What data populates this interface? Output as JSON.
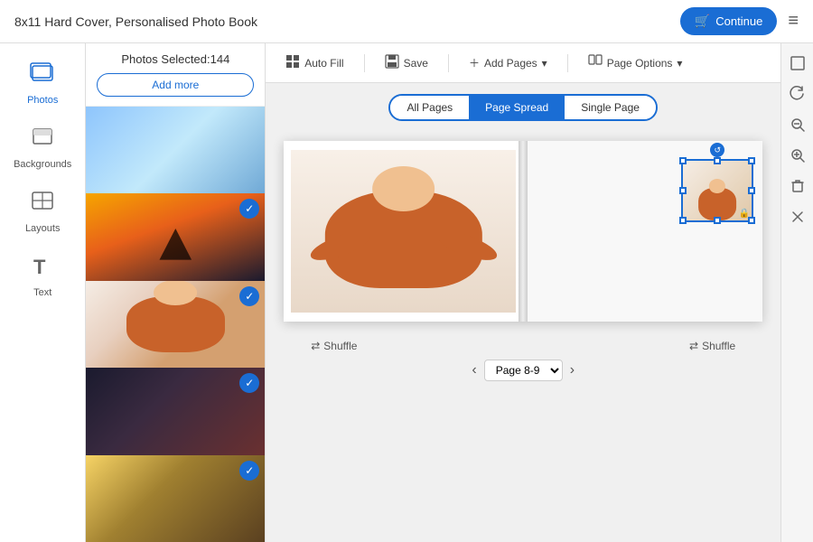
{
  "header": {
    "title": "8x11 Hard Cover, Personalised Photo Book",
    "continue_label": "Continue"
  },
  "toolbar": {
    "autofill_label": "Auto Fill",
    "save_label": "Save",
    "add_pages_label": "Add Pages",
    "page_options_label": "Page Options"
  },
  "view_tabs": {
    "all_pages_label": "All Pages",
    "page_spread_label": "Page Spread",
    "single_page_label": "Single Page",
    "active": "page_spread"
  },
  "sidebar": {
    "items": [
      {
        "id": "photos",
        "label": "Photos",
        "icon": "🖼"
      },
      {
        "id": "backgrounds",
        "label": "Backgrounds",
        "icon": "🗂"
      },
      {
        "id": "layouts",
        "label": "Layouts",
        "icon": "⊞"
      },
      {
        "id": "text",
        "label": "Text",
        "icon": "T"
      }
    ]
  },
  "photos_panel": {
    "selected_count_label": "Photos Selected:",
    "selected_count": "144",
    "add_more_label": "Add more"
  },
  "bottom": {
    "shuffle_left_label": "Shuffle",
    "shuffle_right_label": "Shuffle",
    "page_label": "Page 8-9",
    "prev_icon": "‹",
    "next_icon": "›"
  },
  "right_tools": {
    "icons": [
      "⬜",
      "↺",
      "🔍−",
      "🔍+",
      "🗑",
      "✕"
    ]
  }
}
